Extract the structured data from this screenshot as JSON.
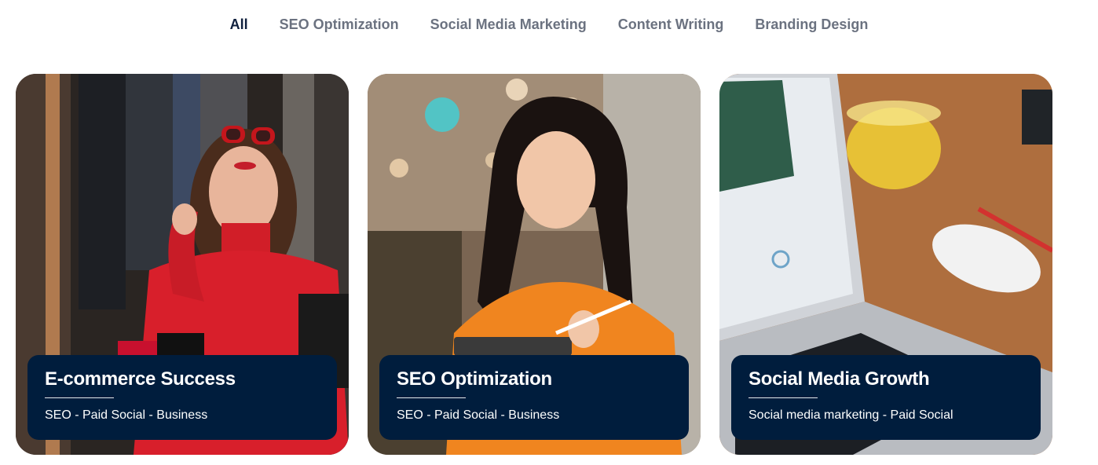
{
  "filters": {
    "tabs": [
      {
        "label": "All",
        "active": true
      },
      {
        "label": "SEO Optimization",
        "active": false
      },
      {
        "label": "Social Media Marketing",
        "active": false
      },
      {
        "label": "Content Writing",
        "active": false
      },
      {
        "label": "Branding Design",
        "active": false
      }
    ]
  },
  "portfolio": {
    "cards": [
      {
        "title": "E-commerce Success",
        "tags": "SEO - Paid Social - Business",
        "image": "woman-red-sweater-photo"
      },
      {
        "title": "SEO Optimization",
        "tags": "SEO - Paid Social - Business",
        "image": "woman-orange-sweater-photo"
      },
      {
        "title": "Social Media Growth",
        "tags": "Social media marketing - Paid Social",
        "image": "laptop-desk-photo"
      }
    ]
  },
  "colors": {
    "overlay_bg": "#001d3d",
    "active_tab": "#0f1f3d",
    "inactive_tab": "#6b7280"
  }
}
